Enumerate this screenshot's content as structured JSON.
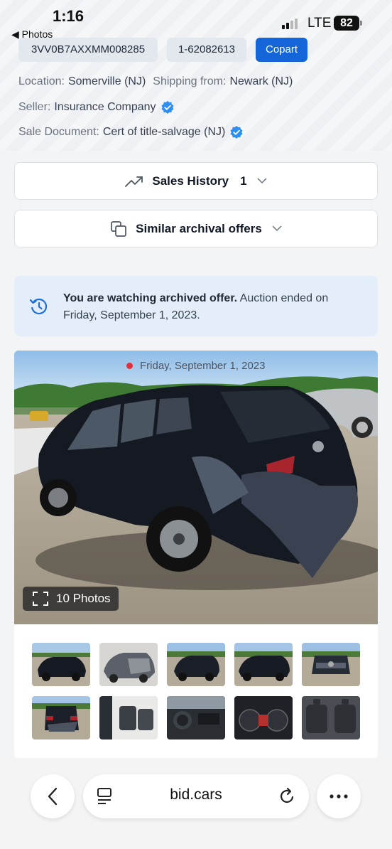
{
  "status_bar": {
    "time": "1:16",
    "back_app": "◀ Photos",
    "network": "LTE",
    "battery": "82"
  },
  "vehicle": {
    "vin": "3VV0B7AXXMM008285",
    "lot": "1-62082613",
    "auction": "Copart"
  },
  "info": {
    "location_label": "Location:",
    "location_value": "Somerville (NJ)",
    "shipping_label": "Shipping from:",
    "shipping_value": "Newark (NJ)",
    "seller_label": "Seller:",
    "seller_value": "Insurance Company",
    "sale_doc_label": "Sale Document:",
    "sale_doc_value": "Cert of title-salvage (NJ)"
  },
  "sales_history": {
    "label": "Sales History",
    "count": "1"
  },
  "similar_offers": {
    "label": "Similar archival offers"
  },
  "banner": {
    "bold": "You are watching archived offer.",
    "rest": " Auction ended on Friday, September 1, 2023."
  },
  "gallery": {
    "date": "Friday, September 1, 2023",
    "photos_label": "10 Photos"
  },
  "browser": {
    "url": "bid.cars"
  },
  "colors": {
    "accent": "#1466d8",
    "verified": "#2b8ef0",
    "banner_bg": "#e3eefa",
    "live_dot": "#e2303b"
  }
}
